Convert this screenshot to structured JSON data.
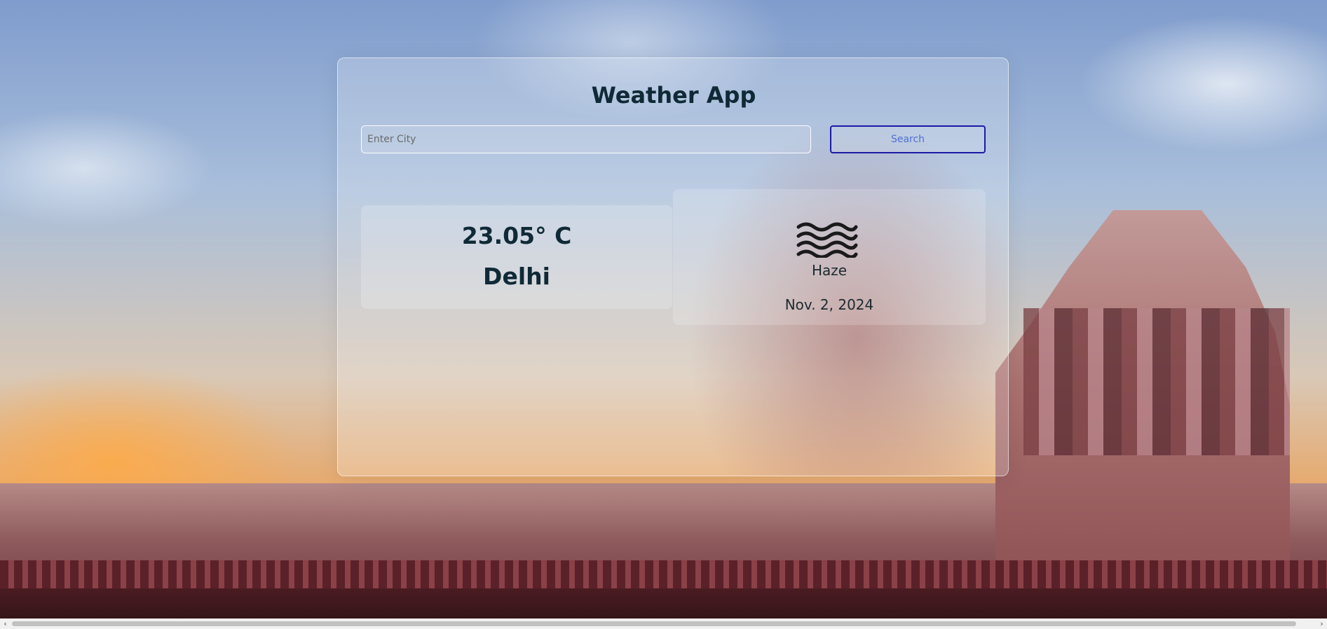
{
  "app": {
    "title": "Weather App"
  },
  "search": {
    "placeholder": "Enter City",
    "value": "",
    "button_label": "Search"
  },
  "weather": {
    "temperature": "23.05° C",
    "city": "Delhi",
    "condition": "Haze",
    "condition_icon": "haze-icon",
    "date": "Nov. 2, 2024"
  },
  "colors": {
    "heading_text": "#0f2a36",
    "button_border": "#1a1aa6",
    "button_text": "#4f6fd4"
  },
  "scrollbar": {
    "left_arrow": "‹",
    "right_arrow": "›"
  }
}
